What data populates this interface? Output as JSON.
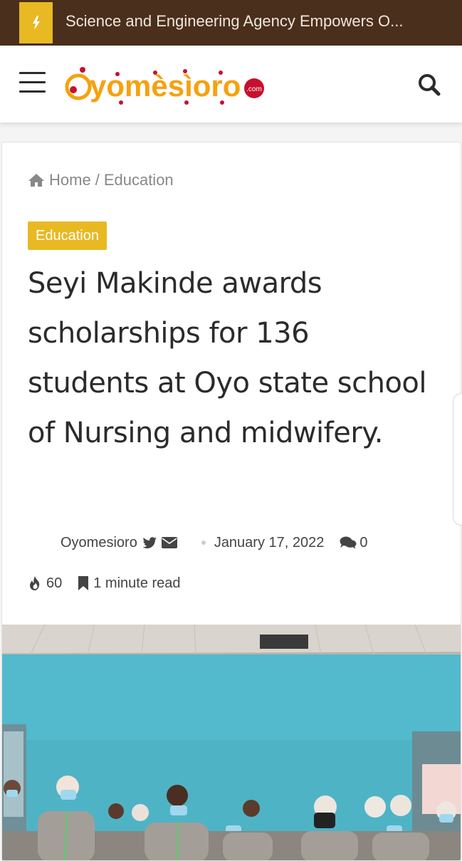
{
  "topbar": {
    "ticker_text": "Science and Engineering Agency Empowers O...",
    "flash_icon": "bolt-icon",
    "accent": "#e8b923",
    "background": "#4a2f1c"
  },
  "header": {
    "logo_text": "yomèsìoro",
    "logo_suffix": ".com",
    "menu_icon": "hamburger-icon",
    "search_icon": "search-icon"
  },
  "breadcrumb": {
    "home_label": "Home",
    "separator": "/",
    "current_label": "Education"
  },
  "article": {
    "category": "Education",
    "title": "Seyi Makinde awards scholarships for 136 students at Oyo state school of Nursing and midwifery.",
    "author": "Oyomesioro",
    "date": "January 17, 2022",
    "comments": "0",
    "views": "60",
    "read_time": "1 minute read"
  },
  "colors": {
    "accent": "#e8b923",
    "logo_orange": "#f5a20f",
    "logo_red": "#c8102e",
    "text": "#2b2b2b"
  }
}
